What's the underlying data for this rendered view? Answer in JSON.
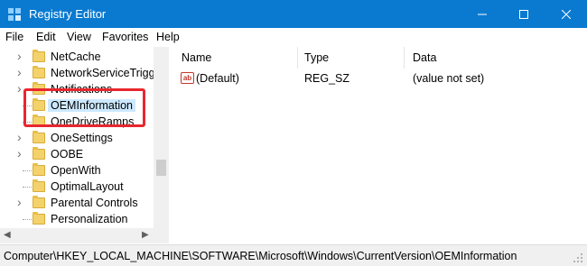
{
  "window": {
    "title": "Registry Editor"
  },
  "menu": [
    "File",
    "Edit",
    "View",
    "Favorites",
    "Help"
  ],
  "tree": {
    "items": [
      {
        "label": "NetCache",
        "expandable": true,
        "selected": false
      },
      {
        "label": "NetworkServiceTrigge",
        "expandable": true,
        "selected": false
      },
      {
        "label": "Notifications",
        "expandable": true,
        "selected": false
      },
      {
        "label": "OEMInformation",
        "expandable": false,
        "selected": true
      },
      {
        "label": "OneDriveRamps",
        "expandable": false,
        "selected": false
      },
      {
        "label": "OneSettings",
        "expandable": true,
        "selected": false
      },
      {
        "label": "OOBE",
        "expandable": true,
        "selected": false
      },
      {
        "label": "OpenWith",
        "expandable": false,
        "selected": false
      },
      {
        "label": "OptimalLayout",
        "expandable": false,
        "selected": false
      },
      {
        "label": "Parental Controls",
        "expandable": true,
        "selected": false
      },
      {
        "label": "Personalization",
        "expandable": false,
        "selected": false
      }
    ]
  },
  "values_pane": {
    "headers": {
      "name": "Name",
      "type": "Type",
      "data": "Data"
    },
    "rows": [
      {
        "icon": "string-value-icon",
        "icon_text": "ab",
        "name": "(Default)",
        "type": "REG_SZ",
        "data": "(value not set)"
      }
    ]
  },
  "statusbar": {
    "path": "Computer\\HKEY_LOCAL_MACHINE\\SOFTWARE\\Microsoft\\Windows\\CurrentVersion\\OEMInformation"
  },
  "colors": {
    "titlebar": "#0a7ad0",
    "selection": "#cce8ff",
    "highlight": "#e8272f"
  }
}
